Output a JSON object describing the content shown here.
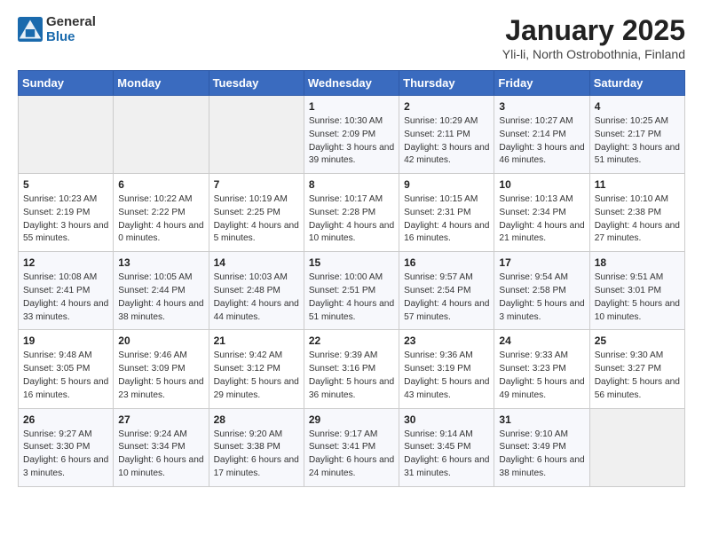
{
  "header": {
    "logo_general": "General",
    "logo_blue": "Blue",
    "title": "January 2025",
    "subtitle": "Yli-li, North Ostrobothnia, Finland"
  },
  "weekdays": [
    "Sunday",
    "Monday",
    "Tuesday",
    "Wednesday",
    "Thursday",
    "Friday",
    "Saturday"
  ],
  "weeks": [
    [
      {
        "day": "",
        "info": ""
      },
      {
        "day": "",
        "info": ""
      },
      {
        "day": "",
        "info": ""
      },
      {
        "day": "1",
        "info": "Sunrise: 10:30 AM\nSunset: 2:09 PM\nDaylight: 3 hours and 39 minutes."
      },
      {
        "day": "2",
        "info": "Sunrise: 10:29 AM\nSunset: 2:11 PM\nDaylight: 3 hours and 42 minutes."
      },
      {
        "day": "3",
        "info": "Sunrise: 10:27 AM\nSunset: 2:14 PM\nDaylight: 3 hours and 46 minutes."
      },
      {
        "day": "4",
        "info": "Sunrise: 10:25 AM\nSunset: 2:17 PM\nDaylight: 3 hours and 51 minutes."
      }
    ],
    [
      {
        "day": "5",
        "info": "Sunrise: 10:23 AM\nSunset: 2:19 PM\nDaylight: 3 hours and 55 minutes."
      },
      {
        "day": "6",
        "info": "Sunrise: 10:22 AM\nSunset: 2:22 PM\nDaylight: 4 hours and 0 minutes."
      },
      {
        "day": "7",
        "info": "Sunrise: 10:19 AM\nSunset: 2:25 PM\nDaylight: 4 hours and 5 minutes."
      },
      {
        "day": "8",
        "info": "Sunrise: 10:17 AM\nSunset: 2:28 PM\nDaylight: 4 hours and 10 minutes."
      },
      {
        "day": "9",
        "info": "Sunrise: 10:15 AM\nSunset: 2:31 PM\nDaylight: 4 hours and 16 minutes."
      },
      {
        "day": "10",
        "info": "Sunrise: 10:13 AM\nSunset: 2:34 PM\nDaylight: 4 hours and 21 minutes."
      },
      {
        "day": "11",
        "info": "Sunrise: 10:10 AM\nSunset: 2:38 PM\nDaylight: 4 hours and 27 minutes."
      }
    ],
    [
      {
        "day": "12",
        "info": "Sunrise: 10:08 AM\nSunset: 2:41 PM\nDaylight: 4 hours and 33 minutes."
      },
      {
        "day": "13",
        "info": "Sunrise: 10:05 AM\nSunset: 2:44 PM\nDaylight: 4 hours and 38 minutes."
      },
      {
        "day": "14",
        "info": "Sunrise: 10:03 AM\nSunset: 2:48 PM\nDaylight: 4 hours and 44 minutes."
      },
      {
        "day": "15",
        "info": "Sunrise: 10:00 AM\nSunset: 2:51 PM\nDaylight: 4 hours and 51 minutes."
      },
      {
        "day": "16",
        "info": "Sunrise: 9:57 AM\nSunset: 2:54 PM\nDaylight: 4 hours and 57 minutes."
      },
      {
        "day": "17",
        "info": "Sunrise: 9:54 AM\nSunset: 2:58 PM\nDaylight: 5 hours and 3 minutes."
      },
      {
        "day": "18",
        "info": "Sunrise: 9:51 AM\nSunset: 3:01 PM\nDaylight: 5 hours and 10 minutes."
      }
    ],
    [
      {
        "day": "19",
        "info": "Sunrise: 9:48 AM\nSunset: 3:05 PM\nDaylight: 5 hours and 16 minutes."
      },
      {
        "day": "20",
        "info": "Sunrise: 9:46 AM\nSunset: 3:09 PM\nDaylight: 5 hours and 23 minutes."
      },
      {
        "day": "21",
        "info": "Sunrise: 9:42 AM\nSunset: 3:12 PM\nDaylight: 5 hours and 29 minutes."
      },
      {
        "day": "22",
        "info": "Sunrise: 9:39 AM\nSunset: 3:16 PM\nDaylight: 5 hours and 36 minutes."
      },
      {
        "day": "23",
        "info": "Sunrise: 9:36 AM\nSunset: 3:19 PM\nDaylight: 5 hours and 43 minutes."
      },
      {
        "day": "24",
        "info": "Sunrise: 9:33 AM\nSunset: 3:23 PM\nDaylight: 5 hours and 49 minutes."
      },
      {
        "day": "25",
        "info": "Sunrise: 9:30 AM\nSunset: 3:27 PM\nDaylight: 5 hours and 56 minutes."
      }
    ],
    [
      {
        "day": "26",
        "info": "Sunrise: 9:27 AM\nSunset: 3:30 PM\nDaylight: 6 hours and 3 minutes."
      },
      {
        "day": "27",
        "info": "Sunrise: 9:24 AM\nSunset: 3:34 PM\nDaylight: 6 hours and 10 minutes."
      },
      {
        "day": "28",
        "info": "Sunrise: 9:20 AM\nSunset: 3:38 PM\nDaylight: 6 hours and 17 minutes."
      },
      {
        "day": "29",
        "info": "Sunrise: 9:17 AM\nSunset: 3:41 PM\nDaylight: 6 hours and 24 minutes."
      },
      {
        "day": "30",
        "info": "Sunrise: 9:14 AM\nSunset: 3:45 PM\nDaylight: 6 hours and 31 minutes."
      },
      {
        "day": "31",
        "info": "Sunrise: 9:10 AM\nSunset: 3:49 PM\nDaylight: 6 hours and 38 minutes."
      },
      {
        "day": "",
        "info": ""
      }
    ]
  ]
}
